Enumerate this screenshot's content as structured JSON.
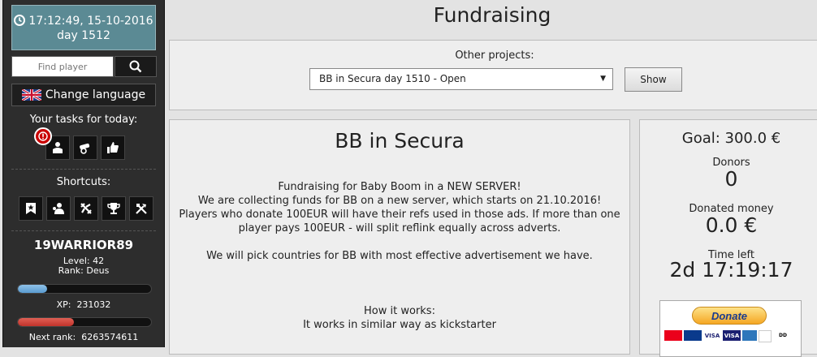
{
  "sidebar": {
    "clock": {
      "time": "17:12:49, 15-10-2016",
      "day": "day 1512"
    },
    "search": {
      "placeholder": "Find player"
    },
    "language_button": "Change language",
    "tasks_title": "Your tasks for today:",
    "shortcuts_title": "Shortcuts:",
    "player": {
      "name": "19WARRIOR89",
      "level": "Level: 42",
      "rank": "Rank: Deus",
      "xp_label": "XP:",
      "xp_value": "231032",
      "xp_progress": 0.22,
      "next_rank_label": "Next rank:",
      "next_rank_value": "6263574611",
      "rank_progress": 0.42
    }
  },
  "page": {
    "title": "Fundraising"
  },
  "other_projects": {
    "label": "Other projects:",
    "selected": "BB in Secura day 1510 - Open",
    "show_button": "Show"
  },
  "project": {
    "title": "BB in Secura",
    "heading": "Fundraising for Baby Boom in a NEW SERVER!",
    "line1": "We are collecting funds for BB on a new server, which starts on 21.10.2016!",
    "line2": "Players who donate 100EUR will have their refs used in those ads. If more than one",
    "line3": "player pays 100EUR - will split reflink equally across adverts.",
    "line4": "We will pick countries for BB with most effective advertisement we have.",
    "how_title": "How it works:",
    "how_text": "It works in similar way as kickstarter"
  },
  "stats": {
    "goal": "Goal: 300.0 €",
    "donors_label": "Donors",
    "donors_value": "0",
    "donated_label": "Donated money",
    "donated_value": "0.0 €",
    "time_label": "Time left",
    "time_value": "2d 17:19:17"
  },
  "donate": {
    "button": "Donate",
    "cards": [
      "VISA",
      "VISA"
    ]
  },
  "colors": {
    "clock_bg": "#5b8a94",
    "xp_bar": "#8fc1e8",
    "rank_bar": "#c0332b",
    "alert": "#c90000"
  }
}
